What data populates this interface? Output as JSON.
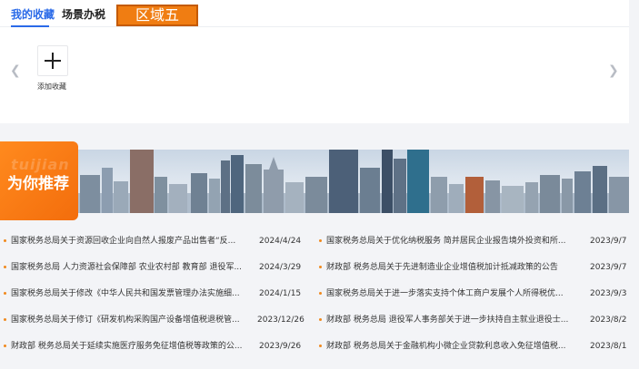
{
  "tabs": [
    {
      "label": "我的收藏"
    },
    {
      "label": "场景办税"
    }
  ],
  "region_tag": "区域五",
  "favorites": {
    "add_label": "添加收藏"
  },
  "recommend": {
    "title": "为你推荐",
    "watermark": "tuijian"
  },
  "colors": {
    "accent": "#2a6ae8",
    "orange": "#f07d12"
  },
  "news_left": [
    {
      "title": "国家税务总局关于资源回收企业向自然人报废产品出售者“反...",
      "date": "2024/4/24"
    },
    {
      "title": "国家税务总局 人力资源社会保障部 农业农村部 教育部 退役军...",
      "date": "2024/3/29"
    },
    {
      "title": "国家税务总局关于修改《中华人民共和国发票管理办法实施细...",
      "date": "2024/1/15"
    },
    {
      "title": "国家税务总局关于修订《研发机构采购国产设备增值税退税管...",
      "date": "2023/12/26"
    },
    {
      "title": "财政部 税务总局关于延续实施医疗服务免征增值税等政策的公...",
      "date": "2023/9/26"
    }
  ],
  "news_right": [
    {
      "title": "国家税务总局关于优化纳税服务 简并居民企业报告境外投资和所...",
      "date": "2023/9/7"
    },
    {
      "title": "财政部 税务总局关于先进制造业企业增值税加计抵减政策的公告",
      "date": "2023/9/7"
    },
    {
      "title": "国家税务总局关于进一步落实支持个体工商户发展个人所得税优...",
      "date": "2023/9/3"
    },
    {
      "title": "财政部 税务总局 退役军人事务部关于进一步扶持自主就业退役士...",
      "date": "2023/8/2"
    },
    {
      "title": "财政部 税务总局关于金融机构小微企业贷款利息收入免征增值税...",
      "date": "2023/8/1"
    }
  ]
}
